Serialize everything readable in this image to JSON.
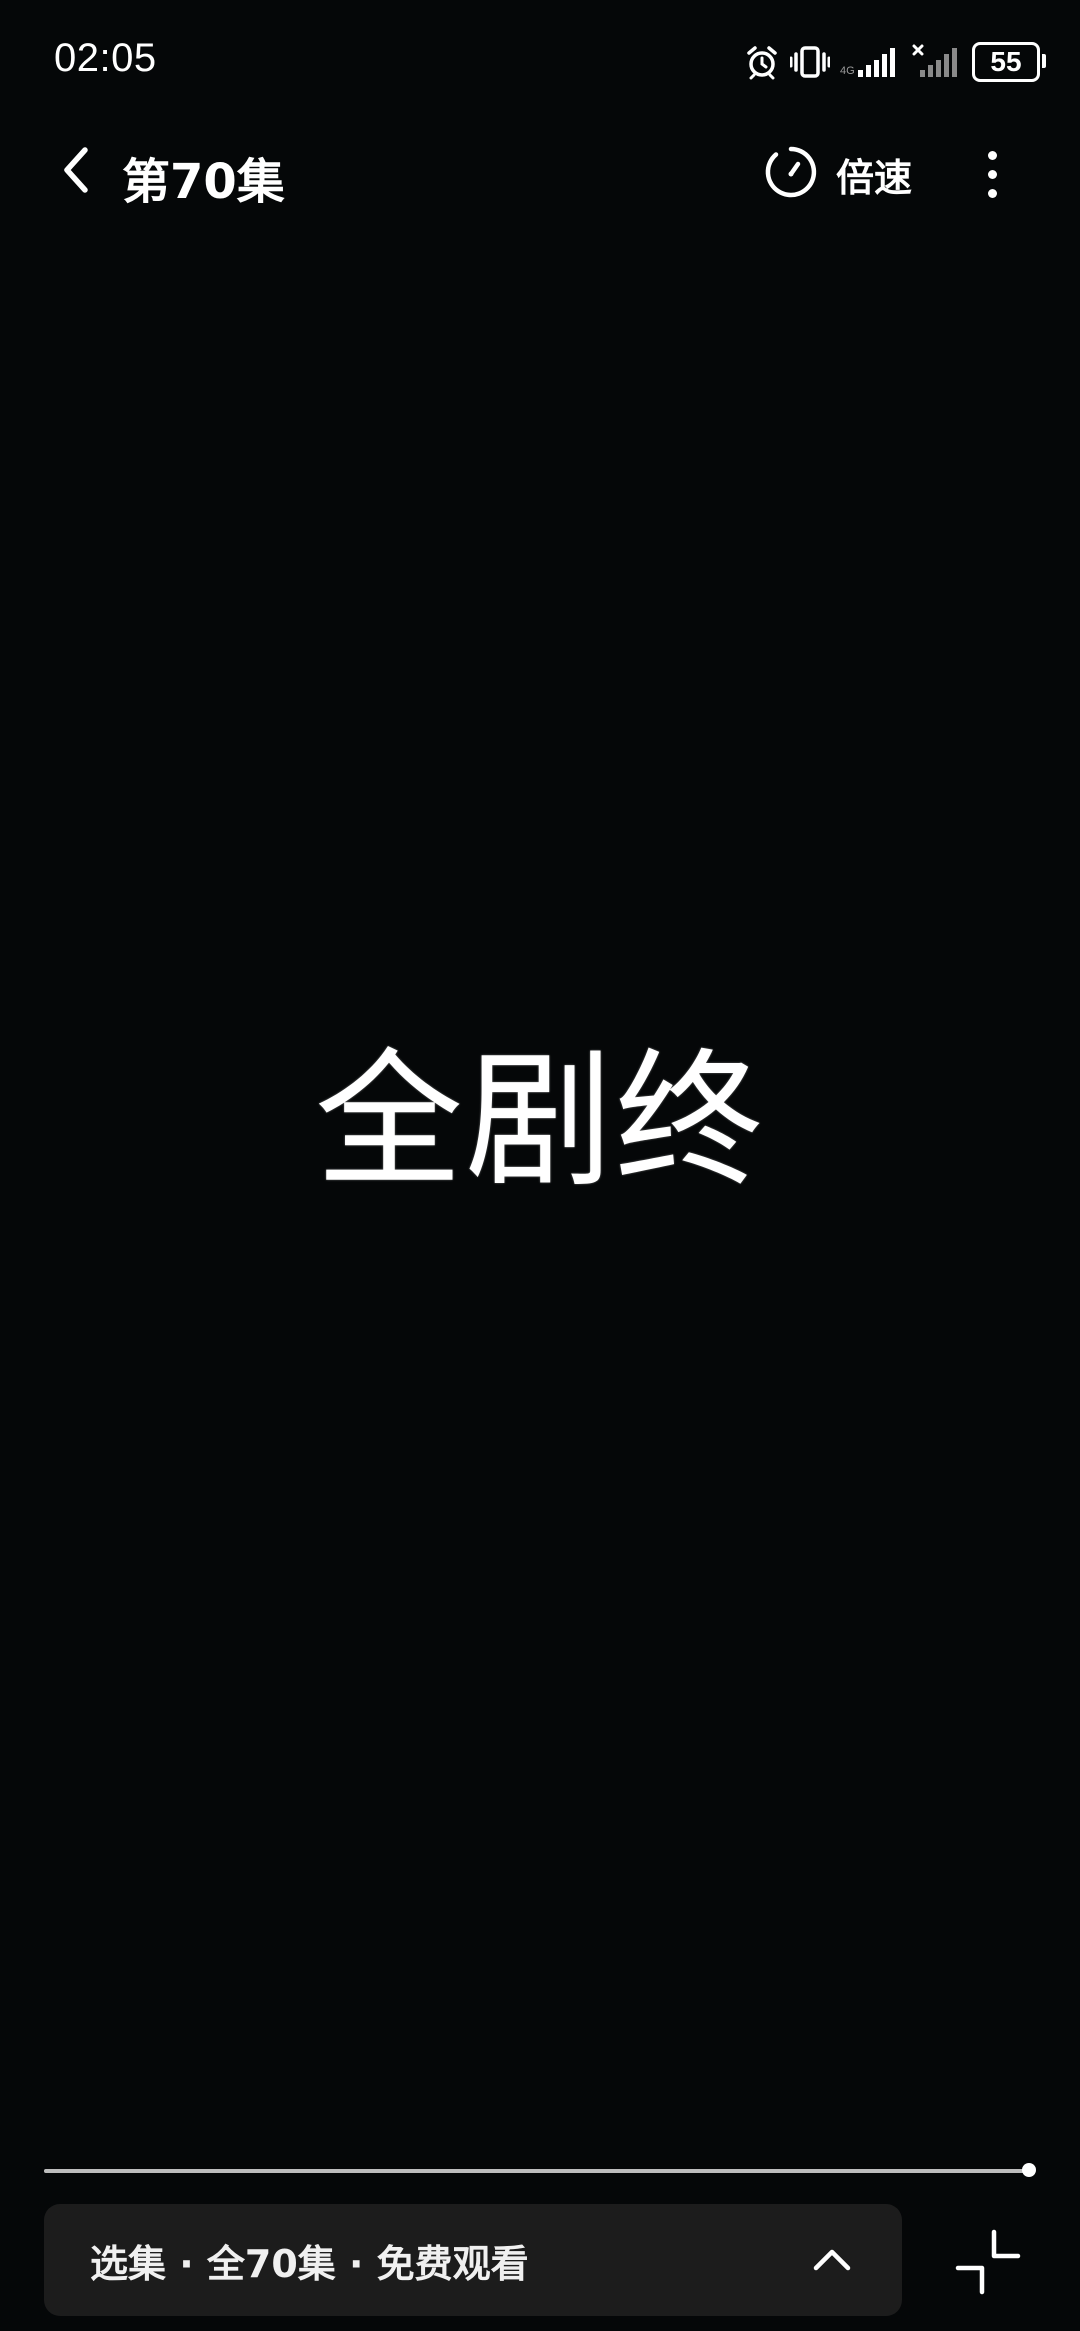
{
  "status_bar": {
    "time": "02:05",
    "battery": "55",
    "icons": [
      "alarm-icon",
      "vibrate-icon",
      "signal-icon",
      "signal-weak-icon",
      "battery-icon"
    ]
  },
  "top_bar": {
    "title": "第70集",
    "speed_label": "倍速",
    "back_icon": "chevron-left-icon",
    "speed_icon": "speedometer-icon",
    "more_icon": "more-vertical-icon"
  },
  "video": {
    "end_text": "全剧终"
  },
  "playback": {
    "progress": 0.995
  },
  "episode_bar": {
    "text": "选集 · 全70集 · 免费观看",
    "toggle_icon": "chevron-up-icon"
  },
  "fullscreen": {
    "icon": "exit-fullscreen-icon"
  },
  "colors": {
    "background": "#050708",
    "bar_background": "#1c1c1c",
    "text": "#ffffff",
    "progress_track": "#5a5a5a",
    "progress_fill": "#bdbdbd"
  }
}
